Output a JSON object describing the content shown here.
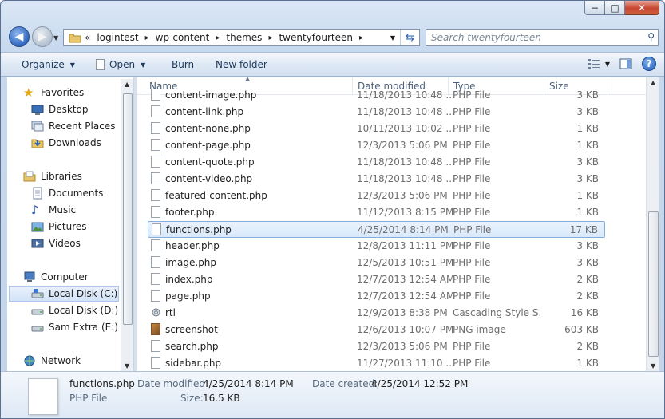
{
  "window": {
    "caption": {
      "minimize": "−",
      "maximize": "□",
      "close": "✕"
    }
  },
  "address": {
    "overflow": "«",
    "crumbs": [
      "logintest",
      "wp-content",
      "themes",
      "twentyfourteen"
    ],
    "search_placeholder": "Search twentyfourteen"
  },
  "toolbar": {
    "organize": "Organize",
    "open": "Open",
    "burn": "Burn",
    "new_folder": "New folder"
  },
  "sidebar": {
    "favorites": "Favorites",
    "favorites_items": [
      "Desktop",
      "Recent Places",
      "Downloads"
    ],
    "libraries": "Libraries",
    "libraries_items": [
      "Documents",
      "Music",
      "Pictures",
      "Videos"
    ],
    "computer": "Computer",
    "computer_items": [
      "Local Disk (C:)",
      "Local Disk (D:)",
      "Sam Extra (E:)"
    ],
    "selected": "Local Disk (C:)",
    "network": "Network"
  },
  "columns": {
    "name": "Name",
    "date": "Date modified",
    "type": "Type",
    "size": "Size"
  },
  "files": [
    {
      "name": "content-image.php",
      "date": "11/18/2013 10:48 ...",
      "type": "PHP File",
      "size": "3 KB",
      "icon": "php-file-icon"
    },
    {
      "name": "content-link.php",
      "date": "11/18/2013 10:48 ...",
      "type": "PHP File",
      "size": "3 KB",
      "icon": "php-file-icon"
    },
    {
      "name": "content-none.php",
      "date": "10/11/2013 10:02 ...",
      "type": "PHP File",
      "size": "1 KB",
      "icon": "php-file-icon"
    },
    {
      "name": "content-page.php",
      "date": "12/3/2013 5:06 PM",
      "type": "PHP File",
      "size": "1 KB",
      "icon": "php-file-icon"
    },
    {
      "name": "content-quote.php",
      "date": "11/18/2013 10:48 ...",
      "type": "PHP File",
      "size": "3 KB",
      "icon": "php-file-icon"
    },
    {
      "name": "content-video.php",
      "date": "11/18/2013 10:48 ...",
      "type": "PHP File",
      "size": "3 KB",
      "icon": "php-file-icon"
    },
    {
      "name": "featured-content.php",
      "date": "12/3/2013 5:06 PM",
      "type": "PHP File",
      "size": "1 KB",
      "icon": "php-file-icon"
    },
    {
      "name": "footer.php",
      "date": "11/12/2013 8:15 PM",
      "type": "PHP File",
      "size": "1 KB",
      "icon": "php-file-icon"
    },
    {
      "name": "functions.php",
      "date": "4/25/2014 8:14 PM",
      "type": "PHP File",
      "size": "17 KB",
      "icon": "php-file-icon",
      "selected": true
    },
    {
      "name": "header.php",
      "date": "12/8/2013 11:11 PM",
      "type": "PHP File",
      "size": "3 KB",
      "icon": "php-file-icon"
    },
    {
      "name": "image.php",
      "date": "12/5/2013 10:51 PM",
      "type": "PHP File",
      "size": "3 KB",
      "icon": "php-file-icon"
    },
    {
      "name": "index.php",
      "date": "12/7/2013 12:54 AM",
      "type": "PHP File",
      "size": "2 KB",
      "icon": "php-file-icon"
    },
    {
      "name": "page.php",
      "date": "12/7/2013 12:54 AM",
      "type": "PHP File",
      "size": "2 KB",
      "icon": "php-file-icon"
    },
    {
      "name": "rtl",
      "date": "12/9/2013 8:38 PM",
      "type": "Cascading Style S...",
      "size": "16 KB",
      "icon": "css-file-icon"
    },
    {
      "name": "screenshot",
      "date": "12/6/2013 10:07 PM",
      "type": "PNG image",
      "size": "603 KB",
      "icon": "png-file-icon"
    },
    {
      "name": "search.php",
      "date": "12/3/2013 5:06 PM",
      "type": "PHP File",
      "size": "2 KB",
      "icon": "php-file-icon"
    },
    {
      "name": "sidebar.php",
      "date": "11/27/2013 11:10 ...",
      "type": "PHP File",
      "size": "1 KB",
      "icon": "php-file-icon"
    }
  ],
  "details": {
    "name": "functions.php",
    "type": "PHP File",
    "modified_label": "Date modified:",
    "modified_value": "4/25/2014 8:14 PM",
    "size_label": "Size:",
    "size_value": "16.5 KB",
    "created_label": "Date created:",
    "created_value": "4/25/2014 12:52 PM"
  }
}
